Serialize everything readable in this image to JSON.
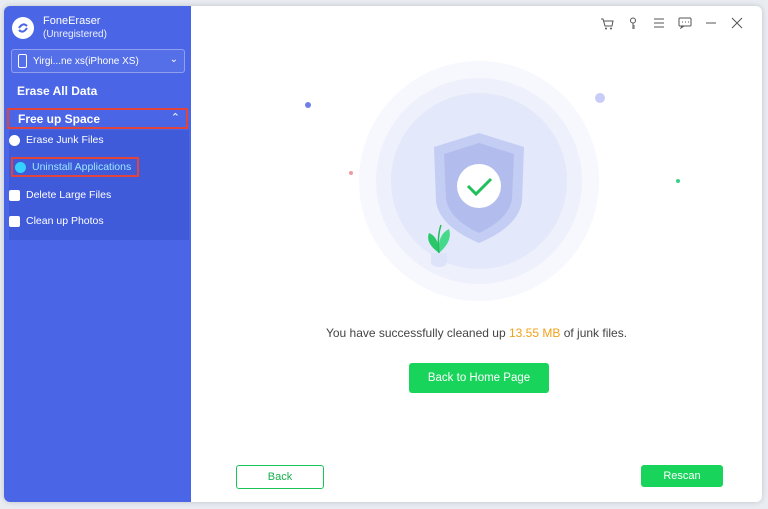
{
  "app": {
    "name": "FoneEraser",
    "status": "(Unregistered)"
  },
  "device": {
    "label": "Yirgi...ne xs(iPhone XS)"
  },
  "sidebar": {
    "erase_all": "Erase All Data",
    "free_up": "Free up Space",
    "items": [
      {
        "label": "Erase Junk Files",
        "icon": "clock-icon"
      },
      {
        "label": "Uninstall Applications",
        "icon": "app-store-icon"
      },
      {
        "label": "Delete Large Files",
        "icon": "file-icon"
      },
      {
        "label": "Clean up Photos",
        "icon": "photo-icon"
      }
    ]
  },
  "toolbar": {
    "icons": [
      "cart-icon",
      "key-icon",
      "menu-icon",
      "feedback-icon",
      "minimize-icon",
      "close-icon"
    ]
  },
  "result": {
    "prefix": "You have successfully cleaned up",
    "size": "13.55 MB",
    "suffix": "of junk files."
  },
  "buttons": {
    "home": "Back to Home Page",
    "back": "Back",
    "rescan": "Rescan"
  },
  "colors": {
    "sidebar": "#4a66e6",
    "accent_green": "#18d45a",
    "highlight": "#f2a21a",
    "selection_border": "#e0443a"
  }
}
